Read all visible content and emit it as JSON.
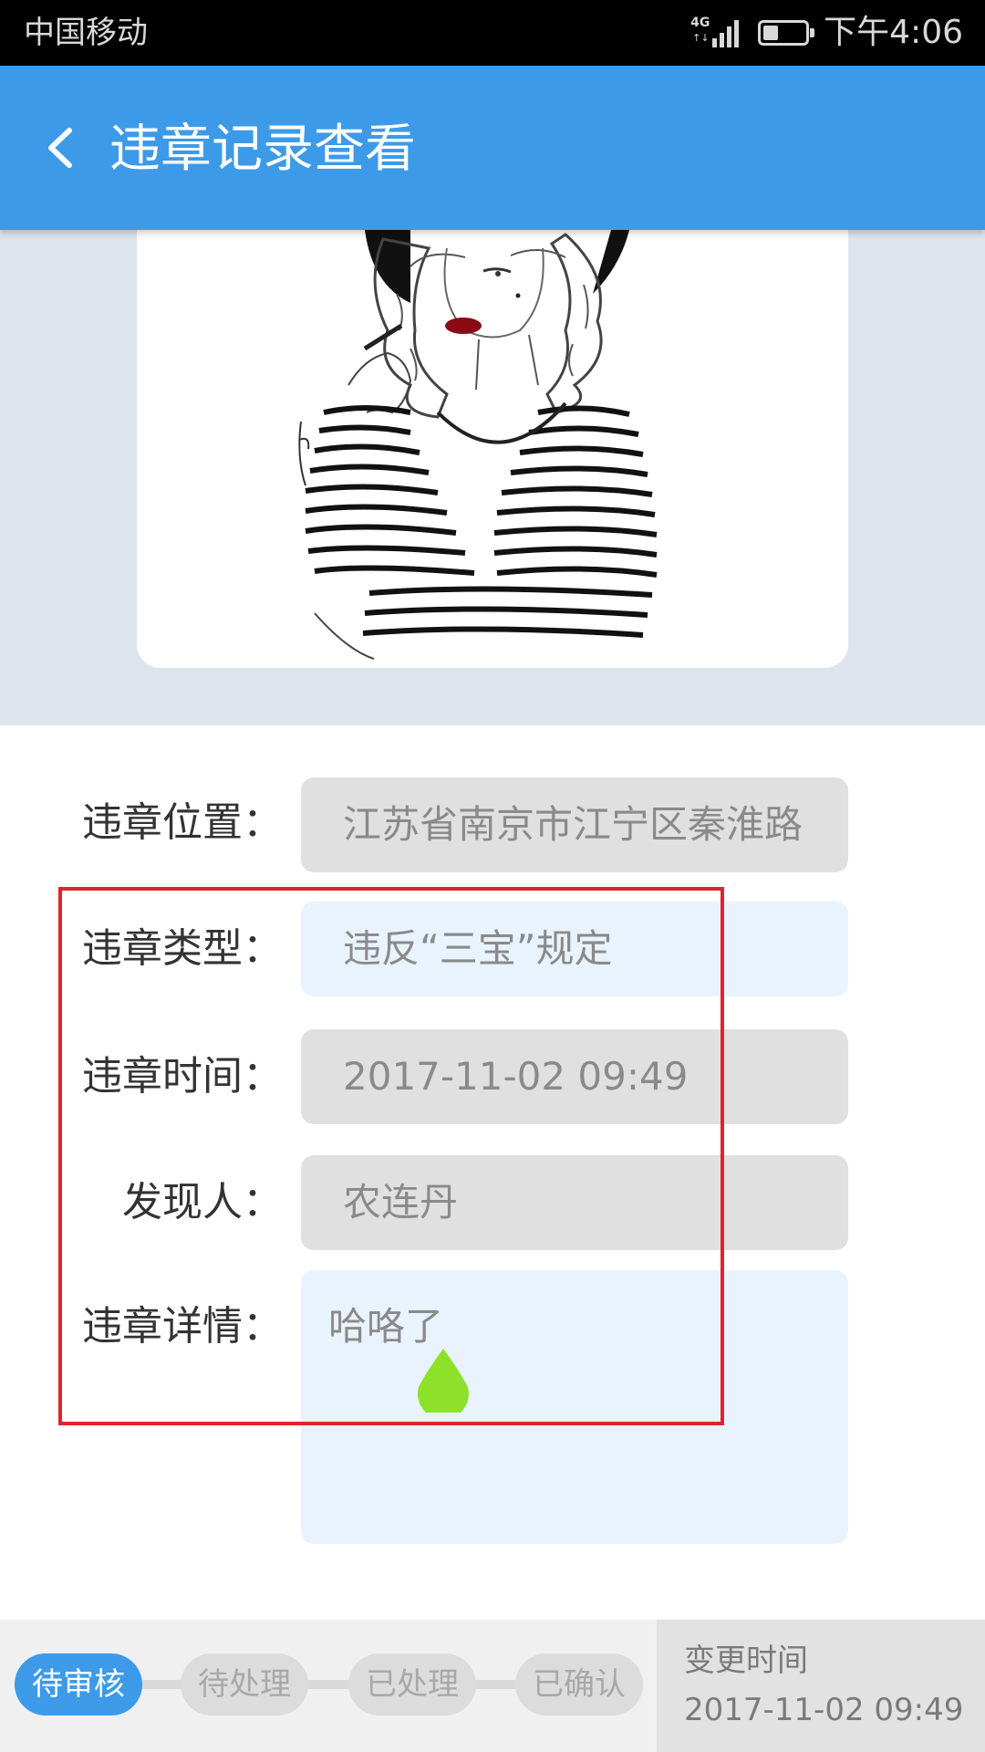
{
  "status_bar": {
    "carrier": "中国移动",
    "network": "4G",
    "time": "下午4:06",
    "battery_level": 0.35
  },
  "header": {
    "title": "违章记录查看",
    "back_icon": "chevron-left-icon"
  },
  "colors": {
    "header_bg": "#3d9ae8",
    "highlight": "#e2232d",
    "touch_marker": "#8ee12a"
  },
  "form": {
    "location_label": "违章位置：",
    "location_value": "江苏省南京市江宁区秦淮路",
    "type_label": "违章类型：",
    "type_value": "违反“三宝”规定",
    "time_label": "违章时间：",
    "time_value": "2017-11-02 09:49",
    "finder_label": "发现人：",
    "finder_value": "农连丹",
    "detail_label": "违章详情：",
    "detail_value": "哈咯了"
  },
  "workflow": {
    "steps": [
      "待审核",
      "待处理",
      "已处理",
      "已确认"
    ],
    "active_index": 0,
    "change_time_label": "变更时间",
    "change_time_value": "2017-11-02 09:49"
  }
}
